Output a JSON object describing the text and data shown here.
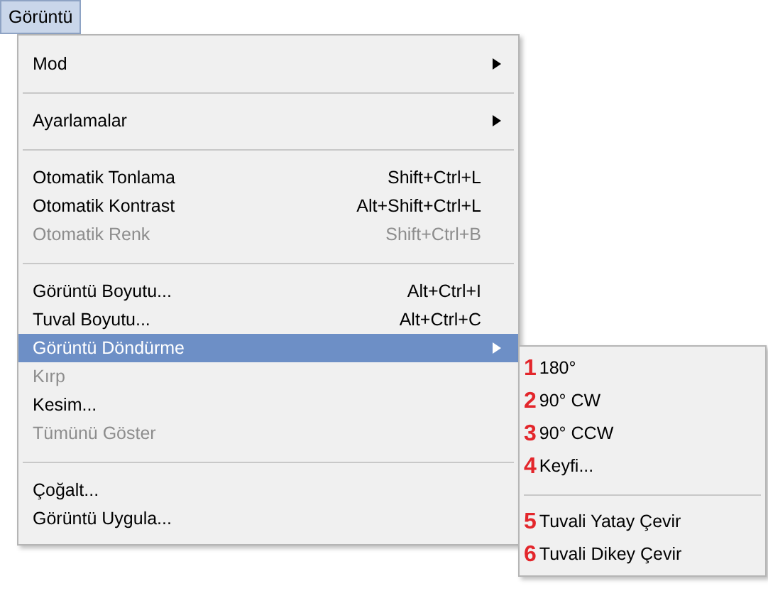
{
  "menu_bar": [
    {
      "label": "Görüntü",
      "selected": true
    }
  ],
  "menu": [
    {
      "kind": "item",
      "label": "Mod",
      "submenu": true,
      "disabled": false,
      "selected": false
    },
    {
      "kind": "separator"
    },
    {
      "kind": "item",
      "label": "Ayarlamalar",
      "submenu": true,
      "disabled": false,
      "selected": false
    },
    {
      "kind": "separator"
    },
    {
      "kind": "item",
      "label": "Otomatik Tonlama",
      "shortcut": "Shift+Ctrl+L",
      "disabled": false,
      "selected": false
    },
    {
      "kind": "item",
      "label": "Otomatik Kontrast",
      "shortcut": "Alt+Shift+Ctrl+L",
      "disabled": false,
      "selected": false
    },
    {
      "kind": "item",
      "label": "Otomatik Renk",
      "shortcut": "Shift+Ctrl+B",
      "disabled": true,
      "selected": false
    },
    {
      "kind": "separator"
    },
    {
      "kind": "item",
      "label": "Görüntü Boyutu...",
      "shortcut": "Alt+Ctrl+I",
      "disabled": false,
      "selected": false
    },
    {
      "kind": "item",
      "label": "Tuval Boyutu...",
      "shortcut": "Alt+Ctrl+C",
      "disabled": false,
      "selected": false
    },
    {
      "kind": "item",
      "label": "Görüntü Döndürme",
      "submenu": true,
      "disabled": false,
      "selected": true
    },
    {
      "kind": "item",
      "label": "Kırp",
      "disabled": true,
      "selected": false
    },
    {
      "kind": "item",
      "label": "Kesim...",
      "disabled": false,
      "selected": false
    },
    {
      "kind": "item",
      "label": "Tümünü Göster",
      "disabled": true,
      "selected": false
    },
    {
      "kind": "separator"
    },
    {
      "kind": "item",
      "label": "Çoğalt...",
      "disabled": false,
      "selected": false
    },
    {
      "kind": "item",
      "label": "Görüntü Uygula...",
      "disabled": false,
      "selected": false
    }
  ],
  "submenu": [
    {
      "kind": "item",
      "number": "1",
      "label": "180°"
    },
    {
      "kind": "item",
      "number": "2",
      "label": "90° CW"
    },
    {
      "kind": "item",
      "number": "3",
      "label": "90° CCW"
    },
    {
      "kind": "item",
      "number": "4",
      "label": "Keyfi..."
    },
    {
      "kind": "separator"
    },
    {
      "kind": "item",
      "number": "5",
      "label": "Tuvali Yatay Çevir"
    },
    {
      "kind": "item",
      "number": "6",
      "label": "Tuvali Dikey Çevir"
    }
  ]
}
